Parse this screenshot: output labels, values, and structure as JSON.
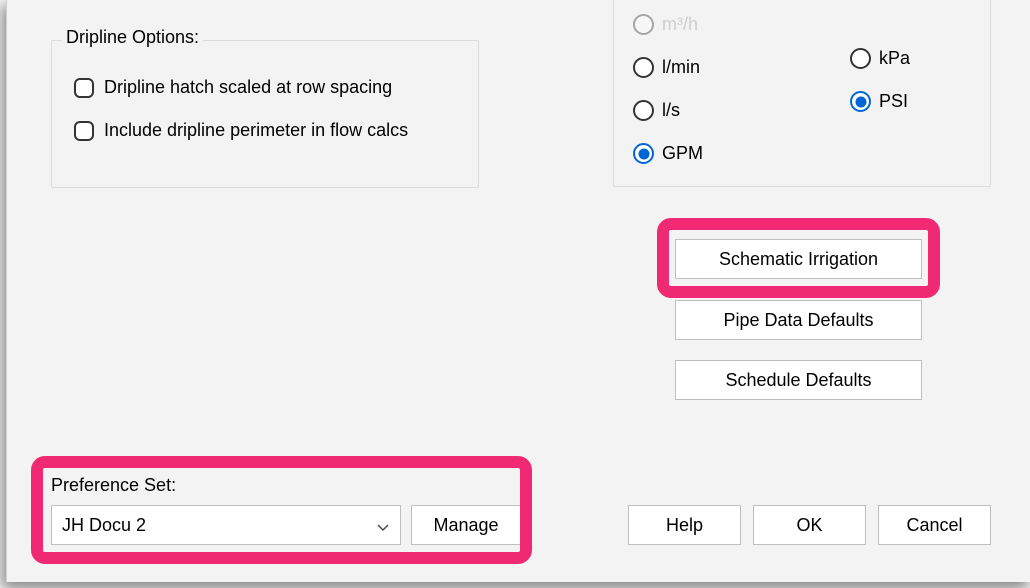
{
  "dripline": {
    "legend": "Dripline Options:",
    "checks": [
      {
        "label": "Dripline hatch scaled at row spacing",
        "checked": false
      },
      {
        "label": "Include dripline perimeter in flow calcs",
        "checked": false
      }
    ]
  },
  "units": {
    "flow_options": [
      {
        "label": "m³/h",
        "ghost": true
      },
      {
        "label": "l/min"
      },
      {
        "label": "l/s"
      },
      {
        "label": "GPM"
      }
    ],
    "flow_selected": "GPM",
    "pressure_options": [
      {
        "label": "kPa"
      },
      {
        "label": "PSI"
      }
    ],
    "pressure_selected": "PSI"
  },
  "right_buttons": {
    "schematic": "Schematic Irrigation",
    "pipe": "Pipe Data Defaults",
    "schedule": "Schedule Defaults"
  },
  "preference_set": {
    "label": "Preference Set:",
    "value": "JH Docu 2",
    "manage": "Manage"
  },
  "actions": {
    "help": "Help",
    "ok": "OK",
    "cancel": "Cancel"
  }
}
